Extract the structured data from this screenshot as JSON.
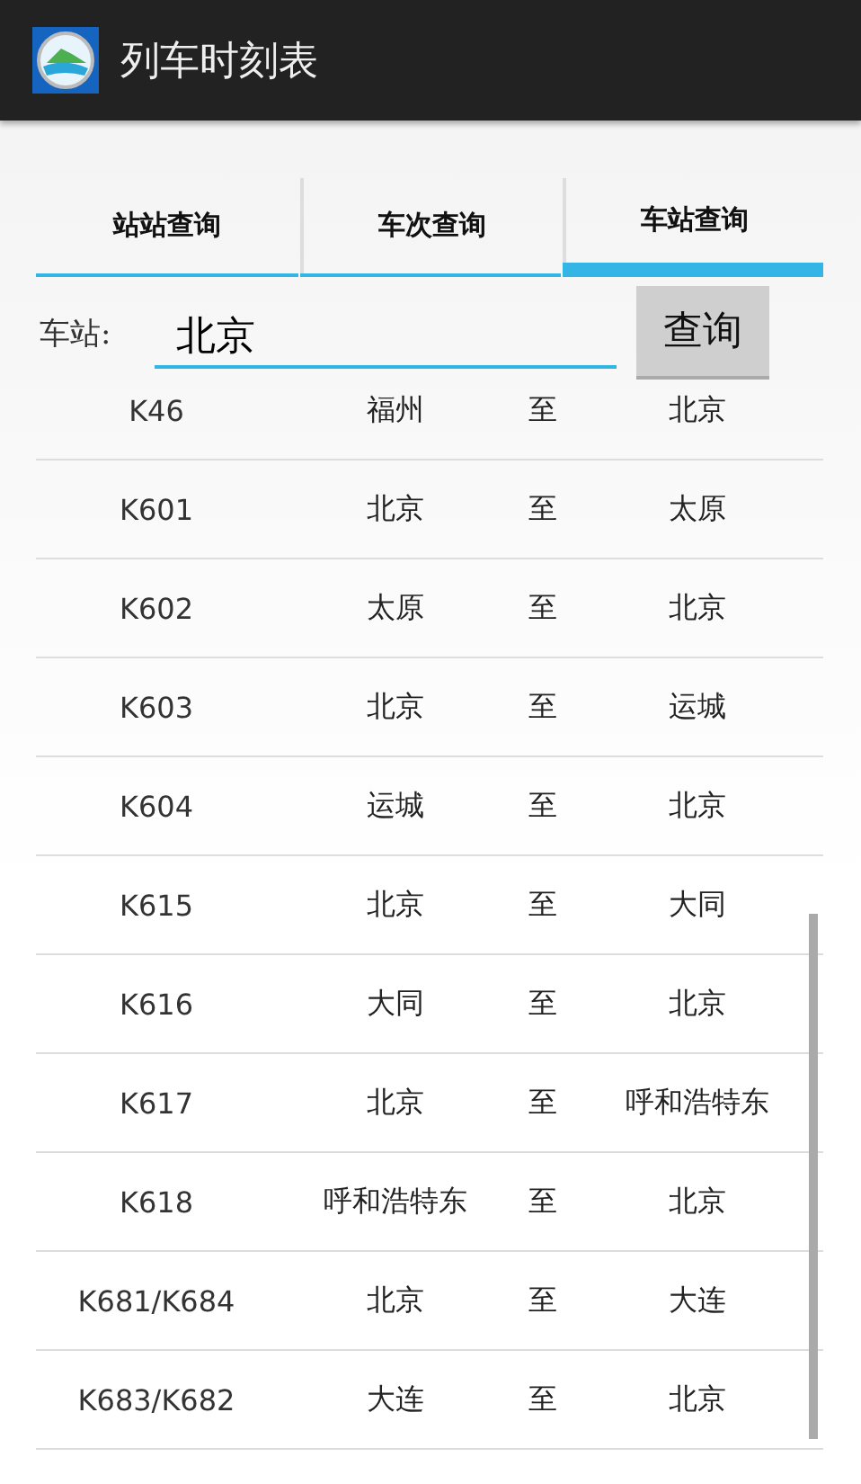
{
  "app_bar": {
    "title": "列车时刻表"
  },
  "tabs": [
    {
      "label": "站站查询",
      "selected": false
    },
    {
      "label": "车次查询",
      "selected": false
    },
    {
      "label": "车站查询",
      "selected": true
    }
  ],
  "search": {
    "label": "车站:",
    "value": "北京",
    "button": "查询"
  },
  "rows": [
    {
      "train": "K46",
      "from": "福州",
      "sep": "至",
      "to": "北京"
    },
    {
      "train": "K601",
      "from": "北京",
      "sep": "至",
      "to": "太原"
    },
    {
      "train": "K602",
      "from": "太原",
      "sep": "至",
      "to": "北京"
    },
    {
      "train": "K603",
      "from": "北京",
      "sep": "至",
      "to": "运城"
    },
    {
      "train": "K604",
      "from": "运城",
      "sep": "至",
      "to": "北京"
    },
    {
      "train": "K615",
      "from": "北京",
      "sep": "至",
      "to": "大同"
    },
    {
      "train": "K616",
      "from": "大同",
      "sep": "至",
      "to": "北京"
    },
    {
      "train": "K617",
      "from": "北京",
      "sep": "至",
      "to": "呼和浩特东"
    },
    {
      "train": "K618",
      "from": "呼和浩特东",
      "sep": "至",
      "to": "北京"
    },
    {
      "train": "K681/K684",
      "from": "北京",
      "sep": "至",
      "to": "大连"
    },
    {
      "train": "K683/K682",
      "from": "大连",
      "sep": "至",
      "to": "北京"
    }
  ]
}
